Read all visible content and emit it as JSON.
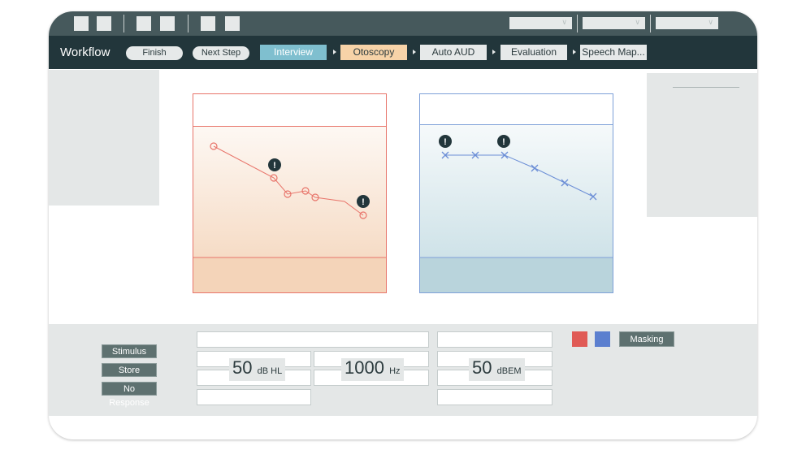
{
  "toolbar": {
    "dropdowns": [
      {
        "icon": "chevron-down-icon"
      },
      {
        "icon": "chevron-down-icon"
      },
      {
        "icon": "chevron-down-icon"
      }
    ]
  },
  "workflow": {
    "title": "Workflow",
    "finish": "Finish",
    "next_step": "Next Step",
    "steps": [
      {
        "label": "Interview",
        "state": "active",
        "color": "#7fbfcf"
      },
      {
        "label": "Otoscopy",
        "state": "highlighted",
        "color": "#f7d3a8"
      },
      {
        "label": "Auto AUD",
        "state": "default"
      },
      {
        "label": "Evaluation",
        "state": "default"
      },
      {
        "label": "Speech Map...",
        "state": "default"
      }
    ]
  },
  "charts": {
    "left": {
      "ear": "right",
      "color": "#e8746a",
      "marker": "circle",
      "warnings": 2
    },
    "right": {
      "ear": "left",
      "color": "#6b8ed6",
      "marker": "cross",
      "warnings": 2
    }
  },
  "controls": {
    "stimulus": "Stimulus",
    "store": "Store",
    "no_response": "No Response",
    "level_value": "50",
    "level_unit": "dB HL",
    "freq_value": "1000",
    "freq_unit": "Hz",
    "mask_value": "50",
    "mask_unit": "dBEM",
    "masking": "Masking",
    "right_color": "#e05a55",
    "left_color": "#5b7fcf"
  }
}
